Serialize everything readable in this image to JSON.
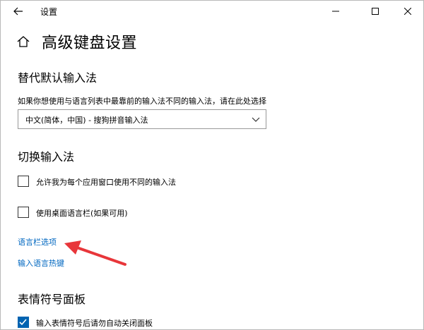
{
  "titlebar": {
    "title": "设置"
  },
  "page": {
    "title": "高级键盘设置"
  },
  "override_input": {
    "heading": "替代默认输入法",
    "description": "如果你想使用与语言列表中最靠前的输入法不同的输入法，请在此处选择",
    "selected": "中文(简体，中国) - 搜狗拼音输入法"
  },
  "switch_input": {
    "heading": "切换输入法",
    "checkbox1": {
      "label": "允许我为每个应用窗口使用不同的输入法",
      "checked": false
    },
    "checkbox2": {
      "label": "使用桌面语言栏(如果可用)",
      "checked": false
    },
    "link1": "语言栏选项",
    "link2": "输入语言热键"
  },
  "emoji_panel": {
    "heading": "表情符号面板",
    "checkbox": {
      "label": "输入表情符号后请勿自动关闭面板",
      "checked": true
    }
  },
  "colors": {
    "accent": "#0063b1",
    "link": "#0067c0",
    "annotation_arrow": "#e8363a"
  }
}
